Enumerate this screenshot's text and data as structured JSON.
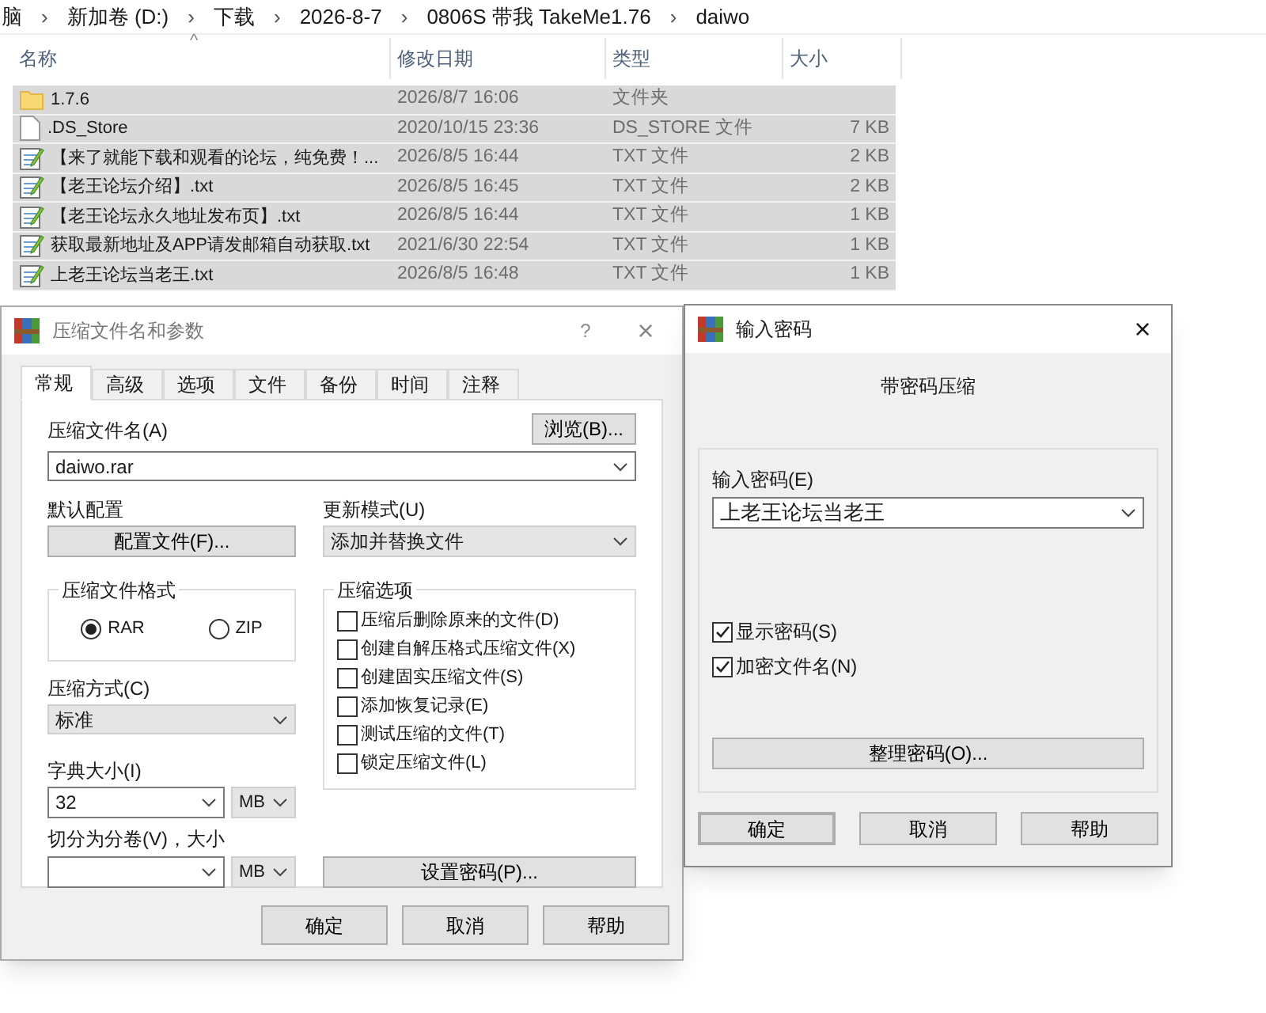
{
  "breadcrumb": [
    "脑",
    "新加卷 (D:)",
    "下载",
    "2026-8-7",
    "0806S 带我 TakeMe1.76",
    "daiwo"
  ],
  "breadcrumb_separator": "›",
  "columns": [
    "名称",
    "修改日期",
    "类型",
    "大小"
  ],
  "sort_indicator": "^",
  "files": [
    {
      "kind": "folder",
      "name": "1.7.6",
      "date": "2026/8/7 16:06",
      "type": "文件夹",
      "selected": true
    },
    {
      "kind": "file",
      "name": ".DS_Store",
      "date": "2020/10/15 23:36",
      "type": "DS_STORE 文件",
      "size": "7 KB",
      "selected": true
    },
    {
      "kind": "txt",
      "name": "【来了就能下载和观看的论坛，纯免费！...",
      "date": "2026/8/5 16:44",
      "type": "TXT 文件",
      "size": "2 KB",
      "selected": true
    },
    {
      "kind": "txt",
      "name": "【老王论坛介绍】.txt",
      "date": "2026/8/5 16:45",
      "type": "TXT 文件",
      "size": "2 KB",
      "selected": true
    },
    {
      "kind": "txt",
      "name": "【老王论坛永久地址发布页】.txt",
      "date": "2026/8/5 16:44",
      "type": "TXT 文件",
      "size": "1 KB",
      "selected": true
    },
    {
      "kind": "txt",
      "name": "获取最新地址及APP请发邮箱自动获取.txt",
      "date": "2021/6/30 22:54",
      "type": "TXT 文件",
      "size": "1 KB",
      "selected": true
    },
    {
      "kind": "txt",
      "name": "上老王论坛当老王.txt",
      "date": "2026/8/5 16:48",
      "type": "TXT 文件",
      "size": "1 KB",
      "selected": true
    }
  ],
  "archive_dialog": {
    "title": "压缩文件名和参数",
    "help": "?",
    "close": "×",
    "tabs": [
      {
        "label": "常规",
        "selected": true
      },
      {
        "label": "高级",
        "selected": false
      },
      {
        "label": "选项",
        "selected": false
      },
      {
        "label": "文件",
        "selected": false
      },
      {
        "label": "备份",
        "selected": false
      },
      {
        "label": "时间",
        "selected": false
      },
      {
        "label": "注释",
        "selected": false
      }
    ],
    "archive_name_label": "压缩文件名(A)",
    "browse_button": "浏览(B)...",
    "archive_name": "daiwo.rar",
    "profile_label": "默认配置",
    "profile_button": "配置文件(F)...",
    "update_mode_label": "更新模式(U)",
    "update_mode": "添加并替换文件",
    "format_group": "压缩文件格式",
    "formats": [
      {
        "label": "RAR",
        "selected": true
      },
      {
        "label": "ZIP",
        "selected": false
      }
    ],
    "options_group": "压缩选项",
    "options": [
      {
        "label": "压缩后删除原来的文件(D)",
        "checked": false
      },
      {
        "label": "创建自解压格式压缩文件(X)",
        "checked": false
      },
      {
        "label": "创建固实压缩文件(S)",
        "checked": false
      },
      {
        "label": "添加恢复记录(E)",
        "checked": false
      },
      {
        "label": "测试压缩的文件(T)",
        "checked": false
      },
      {
        "label": "锁定压缩文件(L)",
        "checked": false
      }
    ],
    "method_label": "压缩方式(C)",
    "method": "标准",
    "dict_label": "字典大小(I)",
    "dict_size": "32",
    "dict_unit": "MB",
    "split_label": "切分为分卷(V)，大小",
    "split_unit": "MB",
    "password_button": "设置密码(P)...",
    "buttons": [
      "确定",
      "取消",
      "帮助"
    ]
  },
  "password_dialog": {
    "title": "输入密码",
    "close": "×",
    "heading": "带密码压缩",
    "password_label": "输入密码(E)",
    "password": "上老王论坛当老王",
    "options": [
      {
        "label": "显示密码(S)",
        "checked": true
      },
      {
        "label": "加密文件名(N)",
        "checked": true
      }
    ],
    "organize_button": "整理密码(O)...",
    "buttons": [
      "确定",
      "取消",
      "帮助"
    ]
  }
}
